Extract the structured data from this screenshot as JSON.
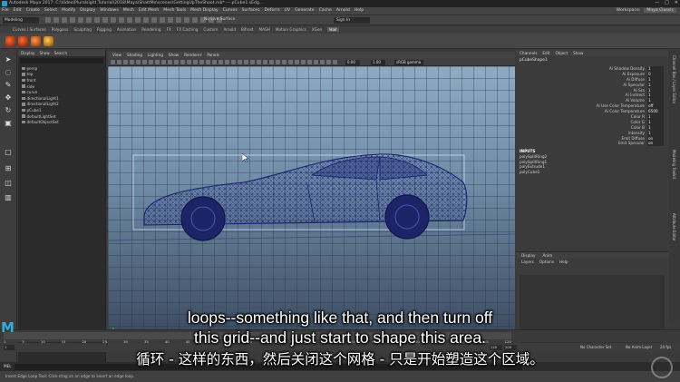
{
  "window": {
    "title": "Autodesk Maya 2017: C:\\Video\\Pluralsight Tutorial\\2018\\Maya\\ShattMe\\scenes\\GettingUpTheShoot.mb* --- pCube1.sEdg...",
    "controls": [
      "—",
      "□",
      "✕"
    ]
  },
  "menubar": {
    "items": [
      "File",
      "Edit",
      "Create",
      "Select",
      "Modify",
      "Display",
      "Windows",
      "Mesh",
      "Edit Mesh",
      "Mesh Tools",
      "Mesh Display",
      "Curves",
      "Surfaces",
      "Deform",
      "UV",
      "Generate",
      "Cache",
      "Arnold",
      "Help"
    ],
    "workspace_label": "Workspace:",
    "workspace_value": "Maya Classic"
  },
  "statusline": {
    "mode": "Modeling",
    "live": "No Live Surface",
    "signin": "Sign In"
  },
  "shelf": {
    "tabs": [
      "Curves / Surfaces",
      "Polygons",
      "Sculpting",
      "Rigging",
      "Animation",
      "Rendering",
      "FX",
      "FX Caching",
      "Custom",
      "Arnold",
      "Bifrost",
      "MASH",
      "Motion Graphics",
      "XGen",
      "Hair"
    ],
    "active_tab": "Hair"
  },
  "outliner": {
    "tabs": [
      "Display",
      "Show",
      "Search"
    ],
    "items": [
      {
        "label": "persp",
        "level": 1
      },
      {
        "label": "top",
        "level": 1
      },
      {
        "label": "front",
        "level": 1
      },
      {
        "label": "side",
        "level": 1
      },
      {
        "label": "curve",
        "level": 1
      },
      {
        "label": "directionalLight1",
        "level": 1
      },
      {
        "label": "directionalLight2",
        "level": 1
      },
      {
        "label": "pCube1",
        "level": 1
      },
      {
        "label": "defaultLightSet",
        "level": 1
      },
      {
        "label": "defaultObjectSet",
        "level": 1
      }
    ]
  },
  "viewport": {
    "menu": [
      "View",
      "Shading",
      "Lighting",
      "Show",
      "Renderer",
      "Panels"
    ],
    "field_values": [
      "0.00",
      "1.00"
    ],
    "colorspace": "sRGB gamma"
  },
  "channelbox": {
    "tabs": [
      "Channels",
      "Edit",
      "Object",
      "Show"
    ],
    "object": "pCubeShape1",
    "attributes": [
      {
        "k": "Ai Shadow Density",
        "v": "1"
      },
      {
        "k": "Ai Exposure",
        "v": "0"
      },
      {
        "k": "Ai Diffuse",
        "v": "1"
      },
      {
        "k": "Ai Specular",
        "v": "1"
      },
      {
        "k": "Ai Sss",
        "v": "1"
      },
      {
        "k": "Ai Indirect",
        "v": "1"
      },
      {
        "k": "Ai Volume",
        "v": "1"
      },
      {
        "k": "Ai Use Color Temperature",
        "v": "off"
      },
      {
        "k": "Ai Color Temperature",
        "v": "6500"
      },
      {
        "k": "Color R",
        "v": "1"
      },
      {
        "k": "Color G",
        "v": "1"
      },
      {
        "k": "Color B",
        "v": "1"
      },
      {
        "k": "Intensity",
        "v": "1"
      },
      {
        "k": "Emit Diffuse",
        "v": "on"
      },
      {
        "k": "Emit Specular",
        "v": "on"
      }
    ],
    "inputs_label": "INPUTS",
    "inputs": [
      "polySplitRing2",
      "polySplitRing1",
      "polyExtrude1",
      "polyCube1"
    ]
  },
  "layers": {
    "tabs": [
      "Display",
      "Anim"
    ],
    "sub": [
      "Layers",
      "Options",
      "Help"
    ]
  },
  "sidetabs": [
    "Channel Box / Layer Editor",
    "Modeling Toolkit",
    "Attribute Editor"
  ],
  "time": {
    "ticks": [
      "1",
      "5",
      "10",
      "15",
      "20",
      "25",
      "30",
      "35",
      "40",
      "45",
      "50",
      "55",
      "60",
      "65",
      "70",
      "75",
      "80",
      "85",
      "90",
      "95",
      "100",
      "105",
      "110",
      "115",
      "120"
    ],
    "start": "1",
    "end": "120",
    "range_end": "200",
    "char_set": "No Character Set",
    "anim_layer": "No Anim Layer",
    "fps": "24 fps"
  },
  "mel": {
    "label": "MEL"
  },
  "helpline": {
    "text": "Insert Edge Loop Tool: Click-drag on an edge to insert an edge loop."
  },
  "subtitles": {
    "line1": "loops--something like that, and then turn off",
    "line2": "this grid--and just start to shape this area.",
    "line3": "循环 - 这样的东西，然后关闭这个网格 - 只是开始塑造这个区域。"
  },
  "logo": "M",
  "colors": {
    "accent": "#27b0d8",
    "wire": "#1a237e"
  }
}
